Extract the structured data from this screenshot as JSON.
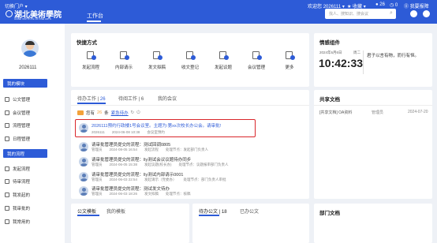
{
  "topbar": {
    "portal_switch": "切换门户",
    "school_name": "湖北美術學院",
    "school_name_en": "HUBEI INSTITUTE OF FINE ARTS",
    "nav_active": "工作台",
    "welcome": "欢迎您",
    "user_id": "2026111",
    "favorites": "收藏",
    "badge_messages": "26",
    "badge_notices": "0",
    "help": "我要报障",
    "search_placeholder": "找人、搜知识、搜会议"
  },
  "sidebar": {
    "username": "2026111",
    "section1": "我的模块",
    "section1_items": [
      "公文管理",
      "会议管理",
      "流程管理",
      "日程管理"
    ],
    "section2": "我的流程",
    "section2_items": [
      "发起流程",
      "待审流程",
      "我发起的",
      "我审批的",
      "我常用的"
    ]
  },
  "quick": {
    "title": "快捷方式",
    "items": [
      "发起流程",
      "内部请示",
      "发文拟稿",
      "收文登记",
      "发起议题",
      "会议管理",
      "更多"
    ]
  },
  "todo": {
    "tabs": [
      {
        "label": "待办工作",
        "count": "26"
      },
      {
        "label": "待阅工作",
        "count": "6"
      },
      {
        "label": "我的会议",
        "count": ""
      }
    ],
    "notice_prefix": "您有",
    "notice_count": "26",
    "notice_suffix": "条",
    "notice_link": "紧急待办",
    "rows": [
      {
        "title": "2026111预约行政楼1号会议室。主题为:第xx次校长办公会。请审批!",
        "meta": [
          "2026111",
          "2024-06-08 10:38",
          "会议室预约"
        ],
        "highlight": true
      },
      {
        "title": "请审批管理员提交的流程：测试回调0805",
        "meta": [
          "管理员",
          "2024-08-05 16:54",
          "发起流程",
          "处理节点：发起部门负责人"
        ],
        "highlight": false
      },
      {
        "title": "请审批管理员提交的流程：lly测试会议议题待办同步",
        "meta": [
          "管理员",
          "2024-06-05 15:38",
          "发起议题(校长办)",
          "处理节点：议题报审部门负责人"
        ],
        "highlight": false
      },
      {
        "title": "请审批管理员提交的流程：lly测试内部请示0001",
        "meta": [
          "管理员",
          "2024-06-03 22:54",
          "发起请示（党委办）",
          "处理节点：部门负责人审批"
        ],
        "highlight": false
      },
      {
        "title": "请审批管理员提交的流程：测试发文待办",
        "meta": [
          "管理员",
          "2024-06-03 18:26",
          "发文拟稿",
          "处理节点：核稿"
        ],
        "highlight": false
      }
    ]
  },
  "bottom_left": {
    "tabs": [
      "公文模板",
      "我的模板"
    ]
  },
  "bottom_mid": {
    "tab1": "待办公文",
    "tab1_count": "18",
    "tab2": "已办公文"
  },
  "info_widget": {
    "title": "情感组件",
    "date": "2024年6月6日",
    "weekday": "周二",
    "time": "10:42:33",
    "quote": "君子以言有物，而行有恒。"
  },
  "shared_docs": {
    "title": "共享文档",
    "rows": [
      {
        "name": "[共享文档] OA资料",
        "owner": "管理员",
        "date": "2024-07-20"
      }
    ]
  },
  "dept_docs": {
    "title": "部门文档"
  }
}
